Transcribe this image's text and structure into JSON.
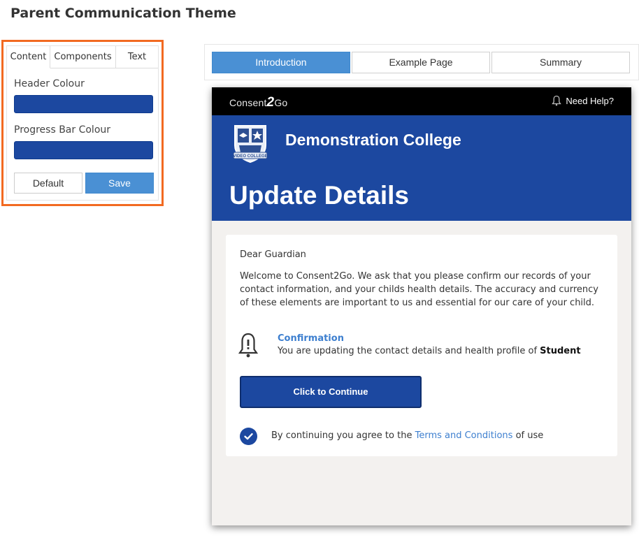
{
  "page": {
    "title": "Parent Communication Theme"
  },
  "settings": {
    "tabs": [
      "Content",
      "Components",
      "Text"
    ],
    "active_tab": "Content",
    "header_colour_label": "Header Colour",
    "header_colour": "#1c48a0",
    "progress_colour_label": "Progress Bar Colour",
    "progress_colour": "#1c48a0",
    "default_label": "Default",
    "save_label": "Save",
    "accent_border": "#f26a21"
  },
  "preview_tabs": {
    "items": [
      "Introduction",
      "Example Page",
      "Summary"
    ],
    "active": "Introduction"
  },
  "preview": {
    "brand_prefix": "Consent",
    "brand_two": "2",
    "brand_suffix": "Go",
    "help_label": "Need Help?",
    "college_name": "Demonstration College",
    "logo_text": "VIDEO COLLEGE",
    "heading": "Update Details",
    "greeting": "Dear Guardian",
    "welcome": "Welcome to Consent2Go. We ask that you please confirm our records of your contact information, and your childs health details. The accuracy and currency of these elements are important to us and essential for our care of your child.",
    "confirm_title": "Confirmation",
    "confirm_text": "You are updating the contact details and health profile of",
    "confirm_name": "Student",
    "continue_label": "Click to Continue",
    "agree_prefix": "By continuing you agree to the",
    "agree_link": "Terms and Conditions",
    "agree_suffix": "of use"
  }
}
